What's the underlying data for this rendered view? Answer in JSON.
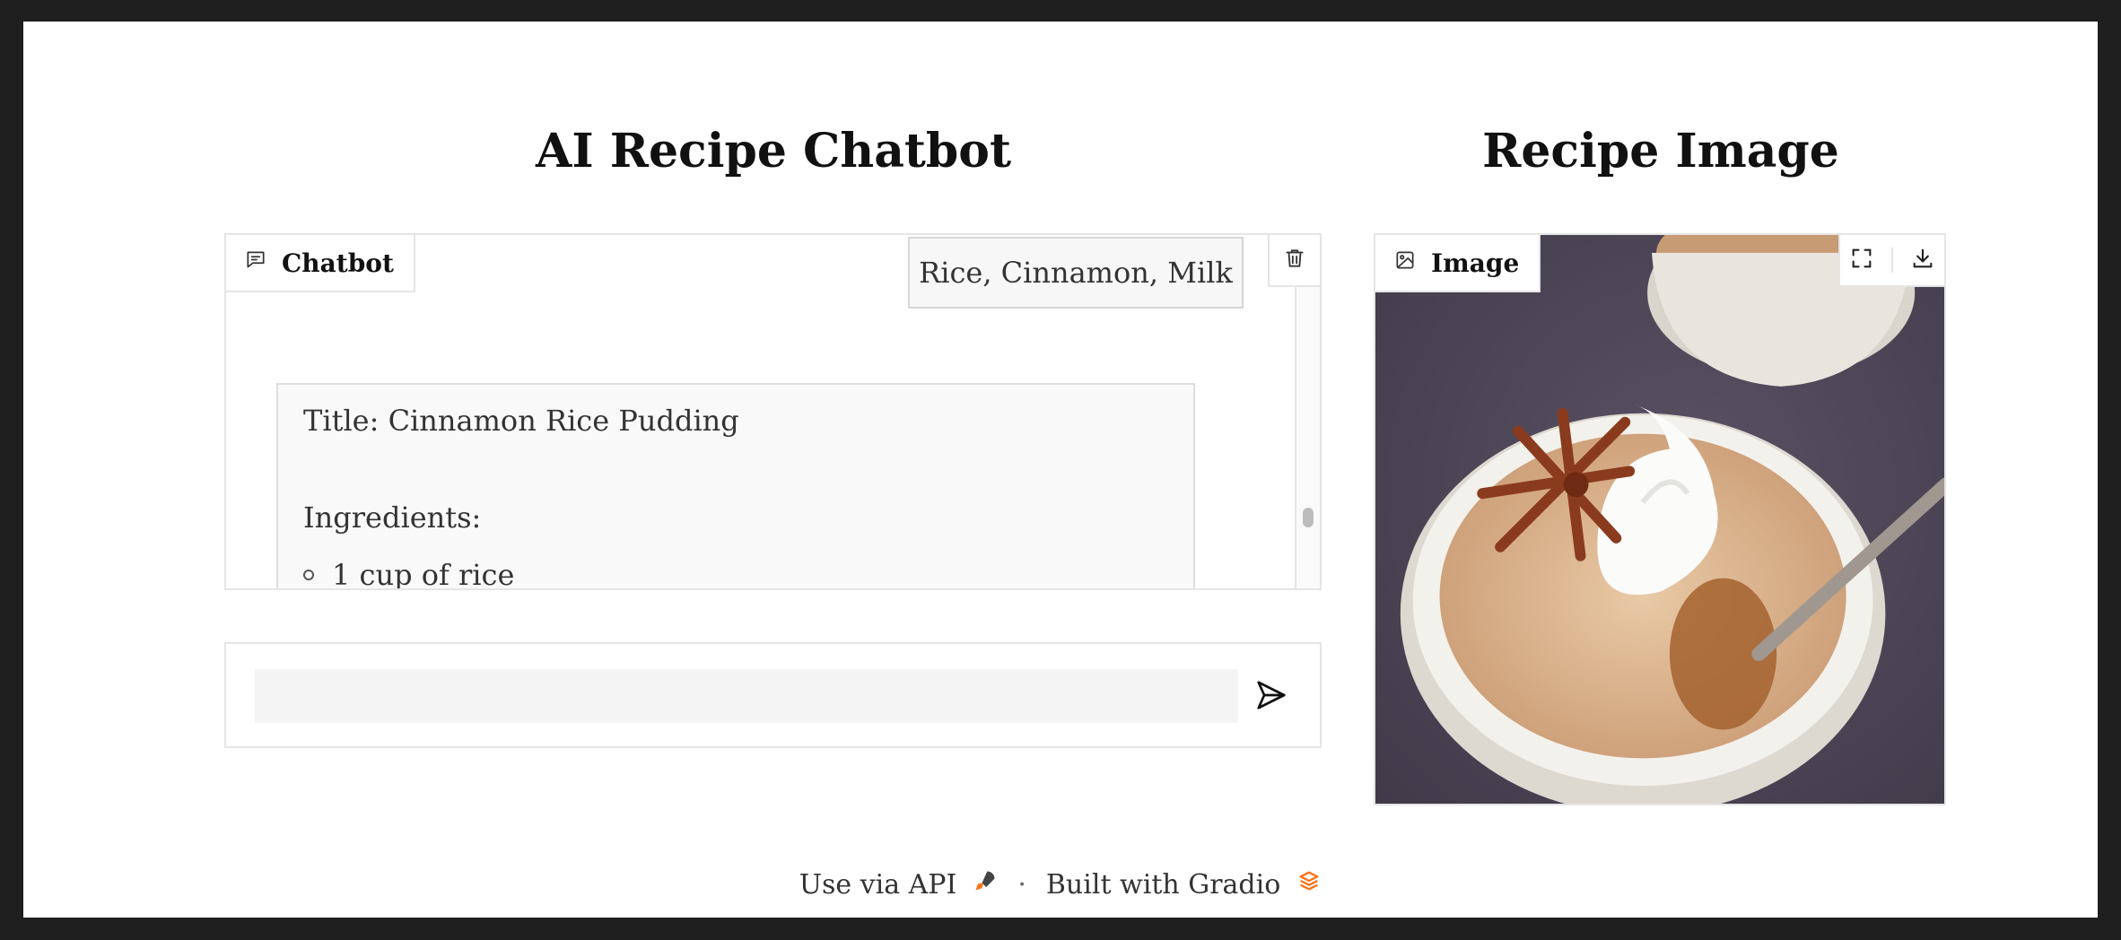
{
  "left_heading": "AI Recipe Chatbot",
  "right_heading": "Recipe Image",
  "chatbot": {
    "label": "Chatbot",
    "label_icon": "chat-bubble-icon",
    "clear_icon": "trash-icon",
    "user_message": "Rice, Cinnamon, Milk",
    "bot_message": {
      "title_line": "Title: Cinnamon Rice Pudding",
      "section": "Ingredients:",
      "items": [
        "1 cup of rice"
      ]
    }
  },
  "input": {
    "value": "",
    "placeholder": "",
    "submit_icon": "send-icon"
  },
  "image_block": {
    "label": "Image",
    "label_icon": "image-icon",
    "tools": [
      "fullscreen-icon",
      "download-icon"
    ],
    "content": "cinnamon rice pudding photo"
  },
  "footer": {
    "api_text": "Use via API",
    "separator": "·",
    "built_text": "Built with Gradio",
    "api_icon": "rocket-icon",
    "gradio_icon": "gradio-logo-icon",
    "accent": "#f97316"
  }
}
